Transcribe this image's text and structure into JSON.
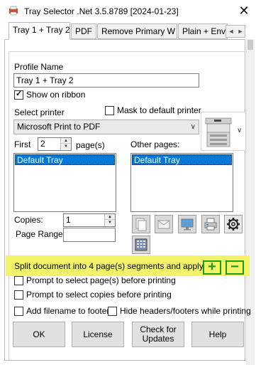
{
  "window": {
    "title": "Tray Selector .Net 3.5.8789 [2024-01-23]",
    "close_glyph": "✕",
    "icon": "printer-app-icon"
  },
  "tabs": [
    {
      "label": "Tray 1 + Tray 2",
      "active": true
    },
    {
      "label": "PDF",
      "active": false
    },
    {
      "label": "Remove Primary W",
      "active": false
    },
    {
      "label": "Plain + Enve",
      "active": false
    }
  ],
  "tab_scroll": {
    "left": "◄",
    "right": "►"
  },
  "profile": {
    "name_label": "Profile Name",
    "name_value": "Tray 1 + Tray 2",
    "show_on_ribbon_label": "Show on ribbon",
    "show_on_ribbon_checked": true
  },
  "printer": {
    "select_label": "Select printer",
    "mask_label": "Mask to default printer",
    "mask_checked": false,
    "selected": "Microsoft Print to PDF",
    "arrow": "∨",
    "image_dropdown_arrow": "∨"
  },
  "first_pages": {
    "first_label": "First",
    "count": "2",
    "pages_label": "page(s)",
    "trays": [
      "Default Tray"
    ]
  },
  "other_pages": {
    "label": "Other pages:",
    "trays": [
      "Default Tray"
    ]
  },
  "copies": {
    "label": "Copies:",
    "value": "1"
  },
  "page_range": {
    "label": "Page Range:",
    "value": ""
  },
  "tool_icons": [
    "copy-pages-icon",
    "email-icon",
    "monitor-icon",
    "printer-icon",
    "settings-gear-icon",
    "barcode-keypad-icon"
  ],
  "split": {
    "text": "Split document into 4 page(s) segments and apply",
    "add_glyph": "+",
    "remove_glyph": "−",
    "highlight_color": "#f3f36a",
    "button_color": "#1a9c1a"
  },
  "options": {
    "prompt_pages": "Prompt to select page(s) before printing",
    "prompt_copies": "Prompt to select copies before printing",
    "add_filename": "Add filename to footer",
    "hide_headers": "Hide headers/footers while printing"
  },
  "buttons": {
    "ok": "OK",
    "license": "License",
    "check_updates_line1": "Check for",
    "check_updates_line2": "Updates",
    "help": "Help"
  }
}
